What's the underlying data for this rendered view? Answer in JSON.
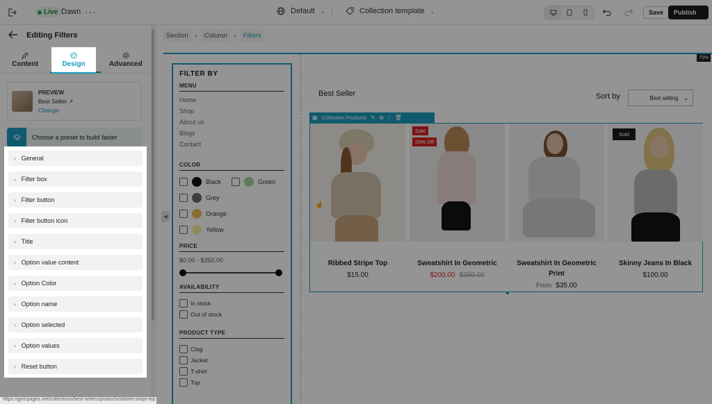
{
  "topbar": {
    "live_label": "Live",
    "theme_name": "Dawn",
    "more": "···",
    "page_select": "Default",
    "template_select": "Collection template",
    "save_label": "Save",
    "publish_label": "Publish"
  },
  "sidebar": {
    "title": "Editing Filters",
    "tabs": [
      {
        "label": "Content",
        "icon": "pencil-icon",
        "active": false
      },
      {
        "label": "Design",
        "icon": "palette-icon",
        "active": true
      },
      {
        "label": "Advanced",
        "icon": "gear-icon",
        "active": false
      }
    ],
    "preview": {
      "label": "PREVIEW",
      "name": "Best Seller",
      "change": "Change"
    },
    "preset_text": "Choose a preset to build faster",
    "settings": [
      "General",
      "Filter box",
      "Filter button",
      "Filter button icon",
      "Title",
      "Option value content",
      "Option Color",
      "Option name",
      "Option selected",
      "Option values",
      "Reset button"
    ],
    "status_url": "https://gempages.net/collections/best-sellers/products/ribbed-stripe-top"
  },
  "canvas": {
    "breadcrumbs": [
      "Section",
      "Column",
      "Filters"
    ],
    "zoom": "75%",
    "filter": {
      "title": "FILTER BY",
      "menu_title": "MENU",
      "menu_items": [
        "Home",
        "Shop",
        "About us",
        "Blogs",
        "Contact"
      ],
      "color_title": "COLOR",
      "colors": [
        {
          "name": "Black",
          "hex": "#111111"
        },
        {
          "name": "Green",
          "hex": "#9ed49a"
        },
        {
          "name": "Grey",
          "hex": "#6a6a6a"
        },
        {
          "name": "Orange",
          "hex": "#f0b85a"
        },
        {
          "name": "Yellow",
          "hex": "#f4ef9a"
        }
      ],
      "price_title": "PRICE",
      "price_range": "$0.00 - $350.00",
      "availability_title": "AVAILABILITY",
      "availability": [
        "In stock",
        "Out of stock"
      ],
      "product_type_title": "PRODUCT TYPE",
      "product_types": [
        "Clog",
        "Jacket",
        "T-shirt",
        "Top"
      ]
    },
    "collection_title": "Best Seller",
    "sort_label": "Sort by",
    "sort_value": "Best selling",
    "toolbar_label": "Collection Products",
    "products": [
      {
        "name": "Ribbed Stripe Top",
        "price": "$15.00"
      },
      {
        "name": "Sweatshirt In Geometric",
        "price": "$200.00",
        "compare": "$250.00",
        "badge": "Sale",
        "badge2": "20% Off"
      },
      {
        "name": "Sweatshirt In Geometric Print",
        "prefix": "From",
        "price": "$35.00"
      },
      {
        "name": "Skinny Jeans In Black",
        "price": "$100.00",
        "badge": "Sold"
      }
    ]
  },
  "colors": {
    "accent": "#1a9bbd",
    "sale": "#d92323",
    "dark": "#1c1c1c"
  }
}
